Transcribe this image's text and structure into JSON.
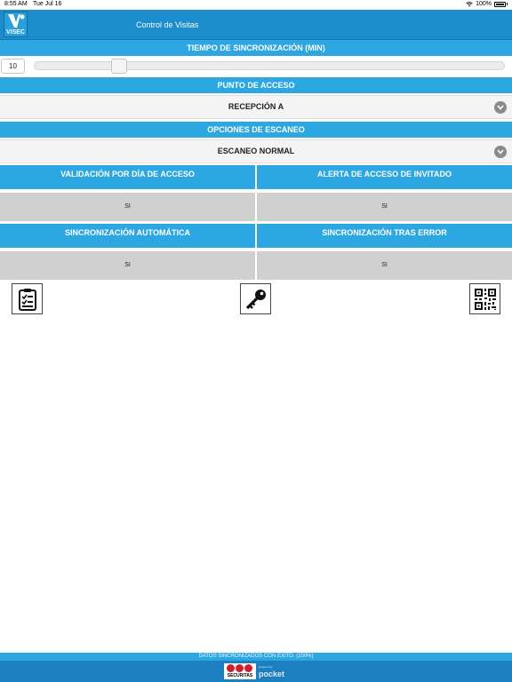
{
  "status_bar": {
    "time": "8:55 AM",
    "date": "Tue Jul 16",
    "battery": "100%"
  },
  "app": {
    "logo_text": "VISEC",
    "title": "Control de Visitas"
  },
  "sync_time": {
    "header": "TIEMPO DE SINCRONIZACIÓN (MIN)",
    "value": "10",
    "slider_fraction": 0.17
  },
  "access_point": {
    "header": "PUNTO DE ACCESO",
    "selected": "RECEPCIÓN A"
  },
  "scan_options": {
    "header": "OPCIONES DE ESCANEO",
    "selected": "ESCANEO NORMAL"
  },
  "options": [
    {
      "label": "VALIDACIÓN POR DÍA DE ACCESO",
      "value": "SI"
    },
    {
      "label": "ALERTA DE ACCESO DE INVITADO",
      "value": "SI"
    },
    {
      "label": "SINCRONIZACIÓN AUTOMÁTICA",
      "value": "SI"
    },
    {
      "label": "SINCRONIZACIÓN TRAS ERROR",
      "value": "SI"
    }
  ],
  "actions": [
    {
      "icon": "clipboard-checklist-icon"
    },
    {
      "icon": "key-icon"
    },
    {
      "icon": "qr-code-icon"
    }
  ],
  "footer": {
    "status": "DATOS SINCRONIZADOS CON ÉXITO. (100%)",
    "brand": "SECURITAS",
    "powered_by": "powered by",
    "partner": "pocket"
  },
  "colors": {
    "nav_blue": "#1c8ccc",
    "header_blue": "#2da7e2",
    "value_gray": "#d0d0d0",
    "brand_red": "#d01e2a"
  }
}
